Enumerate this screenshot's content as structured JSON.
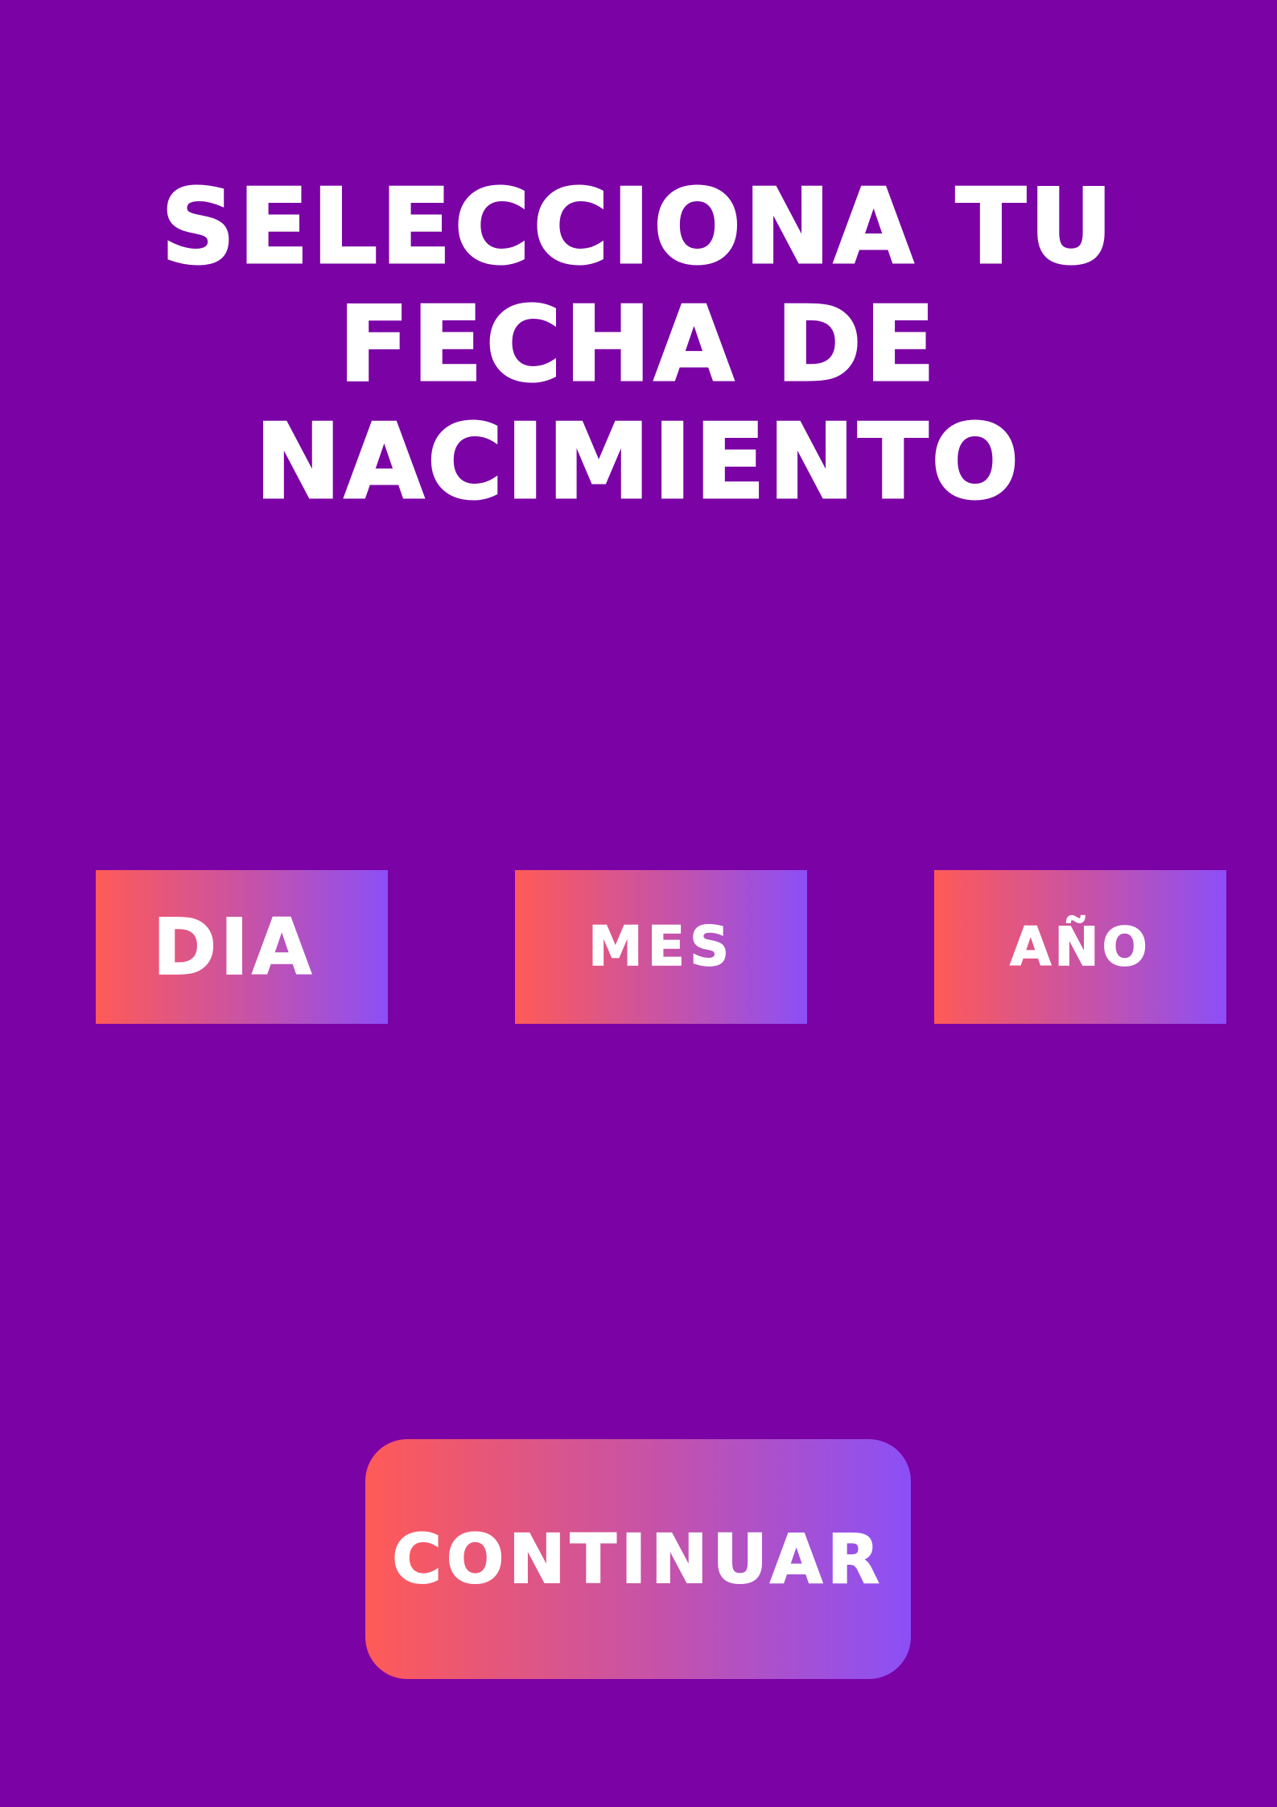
{
  "colors": {
    "background": "#7b02a5",
    "gradient_start": "#ff5a57",
    "gradient_mid": "#c452ab",
    "gradient_end": "#8b4ff7",
    "text": "#ffffff"
  },
  "header": {
    "title_line_1": "SELECCIONA TU",
    "title_line_2": "FECHA DE",
    "title_line_3": "NACIMIENTO"
  },
  "date_selectors": {
    "day_label": "DIA",
    "month_label": "MES",
    "year_label": "AÑO"
  },
  "footer": {
    "continue_label": "CONTINUAR"
  }
}
